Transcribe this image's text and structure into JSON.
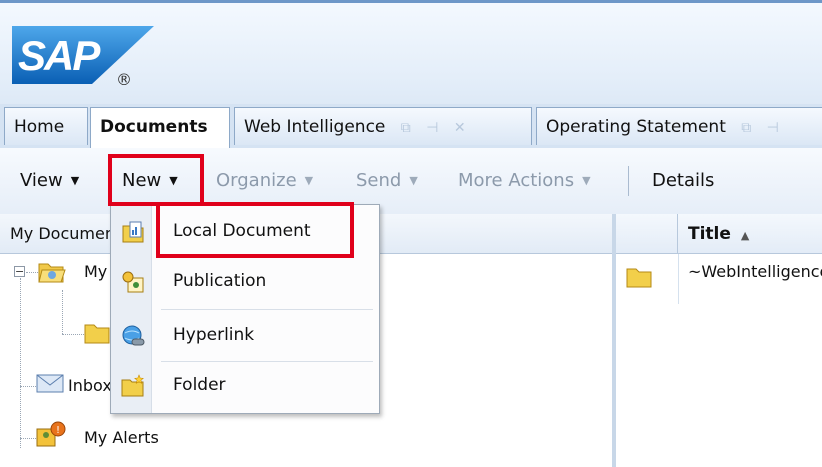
{
  "app": {
    "logo_text": "SAP",
    "logo_mark": "®",
    "brand_color": "#1a6fc2"
  },
  "tabs": [
    {
      "label": "Home",
      "active": false
    },
    {
      "label": "Documents",
      "active": true
    },
    {
      "label": "Web Intelligence",
      "active": false
    },
    {
      "label": "Operating Statement",
      "active": false
    }
  ],
  "toolbar": {
    "view_label": "View",
    "new_label": "New",
    "organize_label": "Organize",
    "send_label": "Send",
    "more_actions_label": "More Actions",
    "details_label": "Details"
  },
  "left_panel": {
    "header": "My Documents",
    "tree": [
      {
        "label": "My Favorites",
        "icon": "open-folder-icon"
      },
      {
        "label": "",
        "icon": "folder-icon"
      },
      {
        "label": "Inbox",
        "icon": "inbox-icon"
      },
      {
        "label": "My Alerts",
        "icon": "alerts-icon"
      }
    ]
  },
  "grid": {
    "column_title": "Title",
    "sort_indicator": "▲",
    "rows": [
      {
        "title": "~WebIntelligence",
        "icon": "folder-icon"
      }
    ]
  },
  "new_menu": {
    "items": [
      {
        "label": "Local Document",
        "icon": "local-document-icon"
      },
      {
        "label": "Publication",
        "icon": "publication-icon"
      },
      {
        "label": "Hyperlink",
        "icon": "hyperlink-icon"
      },
      {
        "label": "Folder",
        "icon": "new-folder-icon"
      }
    ]
  },
  "colors": {
    "highlight": "#e0001b",
    "folder": "#f2cf4a"
  }
}
